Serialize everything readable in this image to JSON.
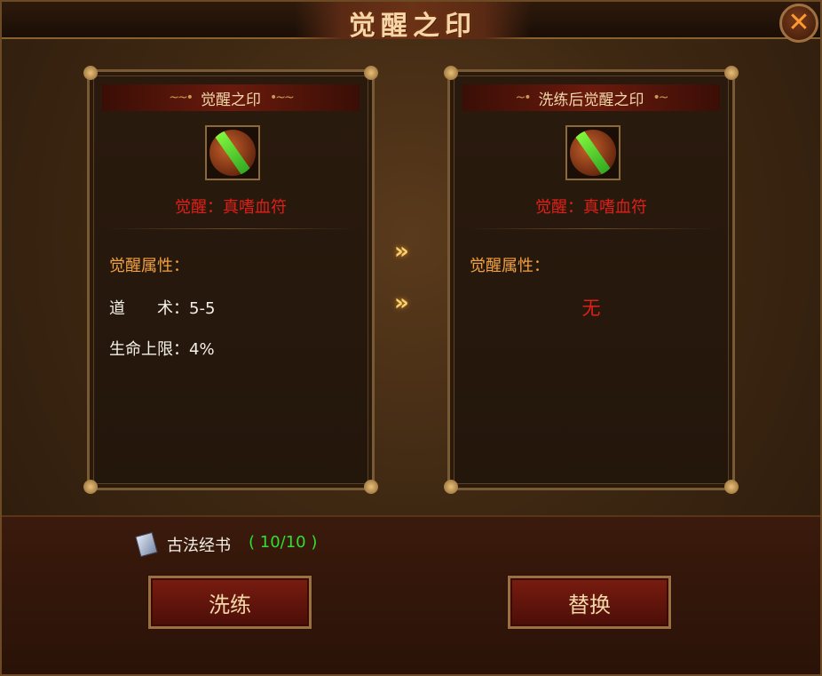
{
  "window": {
    "title": "觉醒之印",
    "close_label": "✕"
  },
  "left_panel": {
    "title": "觉醒之印",
    "item_icon": "talisman-icon",
    "item_name": "觉醒：真嗜血符",
    "attr_heading": "觉醒属性：",
    "stats": [
      {
        "label": "道　　术：",
        "value": "5-5"
      },
      {
        "label": "生命上限：",
        "value": "4%"
      }
    ]
  },
  "right_panel": {
    "title": "洗练后觉醒之印",
    "item_icon": "talisman-icon",
    "item_name": "觉醒：真嗜血符",
    "attr_heading": "觉醒属性：",
    "none_text": "无"
  },
  "arrows": [
    "»",
    "»"
  ],
  "material": {
    "icon": "book-icon",
    "name": "古法经书",
    "count": "( 10/10 )"
  },
  "buttons": {
    "wash": "洗练",
    "replace": "替换"
  },
  "colors": {
    "item_name": "#e02018",
    "attr_heading": "#f0a040",
    "count": "#30e030"
  }
}
